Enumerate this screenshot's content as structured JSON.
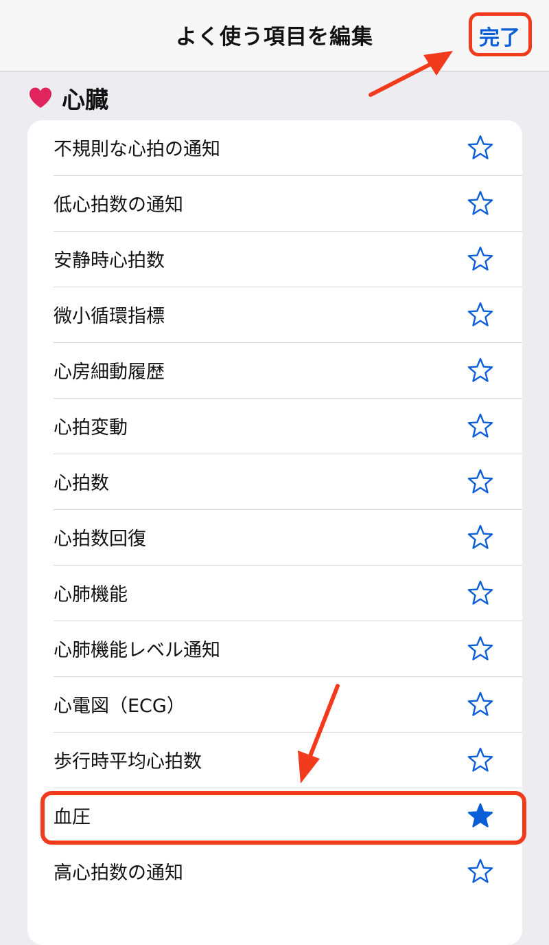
{
  "navbar": {
    "title": "よく使う項目を編集",
    "done_label": "完了"
  },
  "section": {
    "title": "心臓",
    "icon": "heart-icon",
    "icon_color": "#e0245e"
  },
  "accent_color": "#0a5ed8",
  "annotation_color": "#f23a1d",
  "items": [
    {
      "label": "不規則な心拍の通知",
      "favorited": false
    },
    {
      "label": "低心拍数の通知",
      "favorited": false
    },
    {
      "label": "安静時心拍数",
      "favorited": false
    },
    {
      "label": "微小循環指標",
      "favorited": false
    },
    {
      "label": "心房細動履歴",
      "favorited": false
    },
    {
      "label": "心拍変動",
      "favorited": false
    },
    {
      "label": "心拍数",
      "favorited": false
    },
    {
      "label": "心拍数回復",
      "favorited": false
    },
    {
      "label": "心肺機能",
      "favorited": false
    },
    {
      "label": "心肺機能レベル通知",
      "favorited": false
    },
    {
      "label": "心電図（ECG）",
      "favorited": false
    },
    {
      "label": "歩行時平均心拍数",
      "favorited": false
    },
    {
      "label": "血圧",
      "favorited": true
    },
    {
      "label": "高心拍数の通知",
      "favorited": false
    }
  ]
}
